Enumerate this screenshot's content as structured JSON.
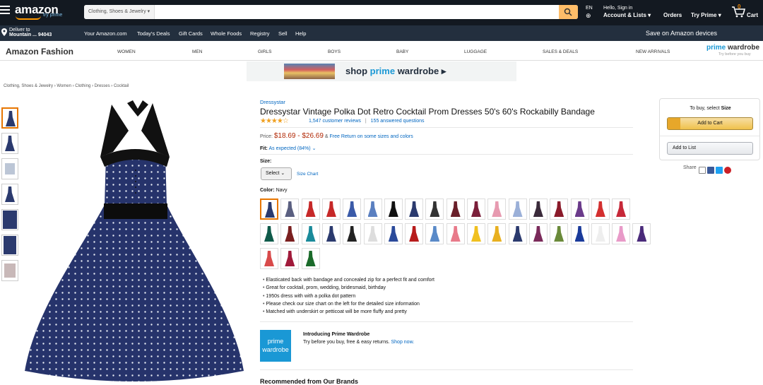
{
  "header": {
    "logo": "amazon",
    "logo_sub": "try prime",
    "search_category": "Clothing, Shoes & Jewelry ▾",
    "search_placeholder": "",
    "lang": "EN",
    "signin_line1": "Hello, Sign in",
    "signin_line2": "Account & Lists ▾",
    "orders": "Orders",
    "tryprime": "Try Prime ▾",
    "cart_count": "0",
    "cart_label": "Cart"
  },
  "subnav": {
    "deliver_line1": "Deliver to",
    "deliver_line2": "Mountain ... 94043",
    "items": [
      "Your Amazon.com",
      "Today's Deals",
      "Gift Cards",
      "Whole Foods",
      "Registry",
      "Sell",
      "Help"
    ],
    "promo": "Save on Amazon devices"
  },
  "fashion": {
    "title": "Amazon Fashion",
    "nav": [
      "WOMEN",
      "MEN",
      "GIRLS",
      "BOYS",
      "BABY",
      "LUGGAGE",
      "SALES & DEALS",
      "NEW ARRIVALS"
    ],
    "pw_logo_a": "prime",
    "pw_logo_b": " wardrobe",
    "pw_sub": "Try before you buy"
  },
  "banner": {
    "text_a": "shop ",
    "text_b": "prime",
    "text_c": " wardrobe ▸"
  },
  "breadcrumb": "Clothing, Shoes & Jewelry › Women › Clothing › Dresses › Cocktail",
  "product": {
    "brand": "Dressystar",
    "title": "Dressystar Vintage Polka Dot Retro Cocktail Prom Dresses 50's 60's Rockabilly Bandage",
    "stars": "★★★★☆",
    "rating": 4.5,
    "reviews": "1,547 customer reviews",
    "separator": "|",
    "questions": "155 answered questions",
    "price_label": "Price:",
    "price": "$18.69 - $26.69",
    "free_return_prefix": " & ",
    "free_return": "Free Return on some sizes and colors",
    "fit_label": "Fit:",
    "fit_value": "As expected (84%)",
    "fit_caret": "⌄",
    "size_label": "Size:",
    "size_select": "Select",
    "size_chart": "Size Chart",
    "color_label": "Color:",
    "color_value": "Navy",
    "swatch_colors": [
      "#2b3a6e",
      "#5a5f80",
      "#c62828",
      "#c62828",
      "#3a5aa8",
      "#5a7fc0",
      "#111",
      "#2b3a6e",
      "#333",
      "#6a1f2a",
      "#7b1f3a",
      "#e79ab0",
      "#9bb0d8",
      "#3a2a3a",
      "#8a1a2a",
      "#6a3a8a",
      "#d32f2f",
      "#c62838",
      "#0f5a4a",
      "#7a1f1f",
      "#1a8a9a",
      "#2b3a6e",
      "#222",
      "#ddd",
      "#2b4a9a",
      "#b71c1c",
      "#5a8ac8",
      "#e87a8a",
      "#f0c020",
      "#e8b020",
      "#2b3a6e",
      "#7a2a5a",
      "#6a8a3a",
      "#1a3a9a",
      "#eee",
      "#e89ac8",
      "#4a2a7a",
      "#d84a4a",
      "#a01a3a",
      "#1a6a2a"
    ],
    "bullets": [
      "Elasticated back with bandage and concealed zip for a perfect fit and comfort",
      "Great for cocktail, prom, wedding, bridesmaid, birthday",
      "1950s dress with with a polka dot pattern",
      "Please check our size chart on the left for the detailed size information",
      "Matched with underskirt or petticoat will be more fluffy and pretty"
    ],
    "pw_box_a": "prime",
    "pw_box_b": "wardrobe",
    "pw_intro": "Introducing Prime Wardrobe",
    "pw_desc": "Try before you buy, free & easy returns. ",
    "pw_link": "Shop now.",
    "recommended": "Recommended from Our Brands"
  },
  "buybox": {
    "prompt_a": "To buy, select ",
    "prompt_b": "Size",
    "add_to_cart": "Add to Cart",
    "add_to_list": "Add to List",
    "share": "Share"
  }
}
